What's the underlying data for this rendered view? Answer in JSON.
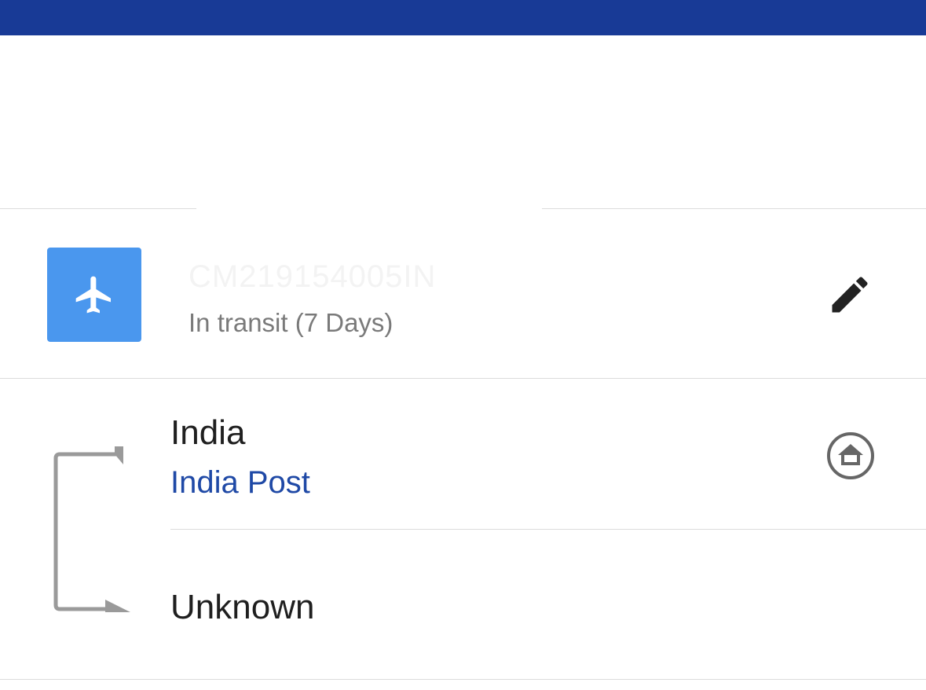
{
  "header": {
    "bar_color": "#183a96"
  },
  "shipment": {
    "tracking_number": "CM219154005IN",
    "status": "In transit (7 Days)",
    "mode_icon": "airplane-icon",
    "mode_color": "#4a97ee",
    "edit_icon": "pencil-icon"
  },
  "route": {
    "origin": {
      "country": "India",
      "carrier": "India Post",
      "icon": "home-icon"
    },
    "destination": {
      "country": "Unknown"
    }
  }
}
